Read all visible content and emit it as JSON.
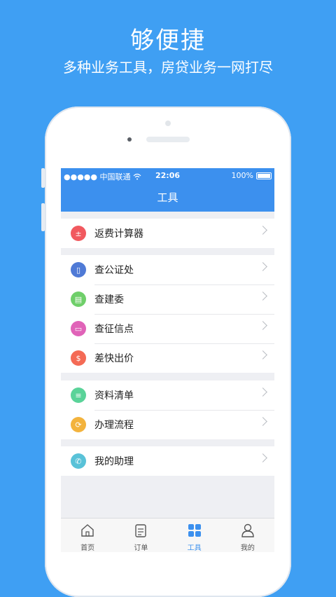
{
  "promo": {
    "headline": "够便捷",
    "subline": "多种业务工具，房贷业务一网打尽"
  },
  "status_bar": {
    "carrier": "●●●●● 中国联通",
    "time": "22:06",
    "battery": "100%"
  },
  "screen_title": "工具",
  "groups": [
    [
      {
        "label": "返费计算器",
        "icon": "calculator-icon",
        "color": "#f1595f"
      }
    ],
    [
      {
        "label": "查公证处",
        "icon": "bookmark-icon",
        "color": "#4f7ad6"
      },
      {
        "label": "查建委",
        "icon": "building-icon",
        "color": "#6fcf6a"
      },
      {
        "label": "查征信点",
        "icon": "card-icon",
        "color": "#e063b8"
      },
      {
        "label": "差快出价",
        "icon": "dollar-icon",
        "color": "#f46a55"
      }
    ],
    [
      {
        "label": "资料清单",
        "icon": "list-icon",
        "color": "#5ad399"
      },
      {
        "label": "办理流程",
        "icon": "refresh-icon",
        "color": "#f3b33d"
      }
    ],
    [
      {
        "label": "我的助理",
        "icon": "phone-icon",
        "color": "#59c2d8"
      }
    ]
  ],
  "tabs": [
    {
      "label": "首页",
      "icon": "home-icon",
      "active": false
    },
    {
      "label": "订单",
      "icon": "clipboard-icon",
      "active": false
    },
    {
      "label": "工具",
      "icon": "grid-icon",
      "active": true
    },
    {
      "label": "我的",
      "icon": "user-icon",
      "active": false
    }
  ],
  "colors": {
    "background": "#3f9ff3",
    "app_bar": "#3c90ee",
    "tab_active": "#3c90ee"
  }
}
